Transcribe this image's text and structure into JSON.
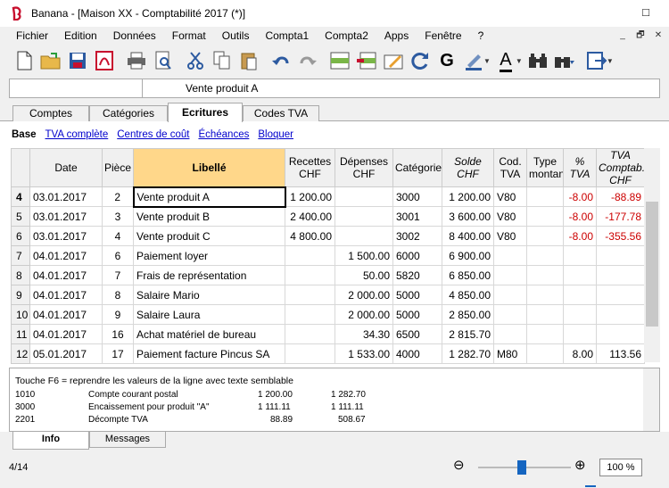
{
  "window": {
    "title": "Banana - [Maison XX - Comptabilité 2017 (*)]",
    "min_glyph": "□"
  },
  "menu": [
    "Fichier",
    "Edition",
    "Données",
    "Format",
    "Outils",
    "Compta1",
    "Compta2",
    "Apps",
    "Fenêtre",
    "?"
  ],
  "mdi_controls": [
    "_",
    "🗗",
    "✕"
  ],
  "toolbar": {
    "icons": [
      "new-document-icon",
      "open-folder-icon",
      "save-icon",
      "pdf-icon",
      "print-icon",
      "print-preview-icon",
      "cut-icon",
      "copy-icon",
      "paste-icon",
      "undo-icon",
      "redo-icon",
      "insert-row-icon",
      "delete-row-icon",
      "edit-icon",
      "recalculate-icon",
      "bold-icon",
      "highlight-icon",
      "font-color-icon",
      "find-icon",
      "find-replace-icon",
      "export-icon"
    ],
    "bold_glyph": "G",
    "font_glyph": "A"
  },
  "formula_bar": {
    "cell_ref": "",
    "cell_value": "Vente produit A"
  },
  "tabs": [
    "Comptes",
    "Catégories",
    "Ecritures",
    "Codes TVA"
  ],
  "active_tab": "Ecritures",
  "views": {
    "base": "Base",
    "links": [
      "TVA complète",
      "Centres de coût",
      "Échéances",
      "Bloquer"
    ]
  },
  "table": {
    "headers": {
      "date": "Date",
      "piece": "Pièce",
      "libelle": "Libellé",
      "recettes": "Recettes CHF",
      "depenses": "Dépenses CHF",
      "categorie": "Catégorie",
      "solde": "Solde CHF",
      "codtva": "Cod. TVA",
      "typemontant": "Type montant",
      "pcttva": "% TVA",
      "tvacomptab": "TVA Comptab. CHF"
    },
    "rows": [
      {
        "n": "4",
        "date": "03.01.2017",
        "piece": "2",
        "libelle": "Vente produit A",
        "recettes": "1 200.00",
        "depenses": "",
        "categorie": "3000",
        "solde": "1 200.00",
        "codtva": "V80",
        "typemontant": "",
        "pcttva": "-8.00",
        "tvacomptab": "-88.89"
      },
      {
        "n": "5",
        "date": "03.01.2017",
        "piece": "3",
        "libelle": "Vente produit B",
        "recettes": "2 400.00",
        "depenses": "",
        "categorie": "3001",
        "solde": "3 600.00",
        "codtva": "V80",
        "typemontant": "",
        "pcttva": "-8.00",
        "tvacomptab": "-177.78"
      },
      {
        "n": "6",
        "date": "03.01.2017",
        "piece": "4",
        "libelle": "Vente produit C",
        "recettes": "4 800.00",
        "depenses": "",
        "categorie": "3002",
        "solde": "8 400.00",
        "codtva": "V80",
        "typemontant": "",
        "pcttva": "-8.00",
        "tvacomptab": "-355.56"
      },
      {
        "n": "7",
        "date": "04.01.2017",
        "piece": "6",
        "libelle": "Paiement loyer",
        "recettes": "",
        "depenses": "1 500.00",
        "categorie": "6000",
        "solde": "6 900.00",
        "codtva": "",
        "typemontant": "",
        "pcttva": "",
        "tvacomptab": ""
      },
      {
        "n": "8",
        "date": "04.01.2017",
        "piece": "7",
        "libelle": "Frais de représentation",
        "recettes": "",
        "depenses": "50.00",
        "categorie": "5820",
        "solde": "6 850.00",
        "codtva": "",
        "typemontant": "",
        "pcttva": "",
        "tvacomptab": ""
      },
      {
        "n": "9",
        "date": "04.01.2017",
        "piece": "8",
        "libelle": "Salaire Mario",
        "recettes": "",
        "depenses": "2 000.00",
        "categorie": "5000",
        "solde": "4 850.00",
        "codtva": "",
        "typemontant": "",
        "pcttva": "",
        "tvacomptab": ""
      },
      {
        "n": "10",
        "date": "04.01.2017",
        "piece": "9",
        "libelle": "Salaire Laura",
        "recettes": "",
        "depenses": "2 000.00",
        "categorie": "5000",
        "solde": "2 850.00",
        "codtva": "",
        "typemontant": "",
        "pcttva": "",
        "tvacomptab": ""
      },
      {
        "n": "11",
        "date": "04.01.2017",
        "piece": "16",
        "libelle": "Achat matériel de bureau",
        "recettes": "",
        "depenses": "34.30",
        "categorie": "6500",
        "solde": "2 815.70",
        "codtva": "",
        "typemontant": "",
        "pcttva": "",
        "tvacomptab": ""
      },
      {
        "n": "12",
        "date": "05.01.2017",
        "piece": "17",
        "libelle": "Paiement facture Pincus SA",
        "recettes": "",
        "depenses": "1 533.00",
        "categorie": "4000",
        "solde": "1 282.70",
        "codtva": "M80",
        "typemontant": "",
        "pcttva": "8.00",
        "tvacomptab": "113.56"
      }
    ]
  },
  "info": {
    "message": "Touche F6 = reprendre les valeurs de la ligne avec texte semblable",
    "rows": [
      {
        "account": "1010",
        "desc": "Compte courant postal",
        "amount": "1 200.00",
        "balance": "1 282.70"
      },
      {
        "account": "3000",
        "desc": "Encaissement pour produit \"A\"",
        "amount": "1 111.11",
        "balance": "1 111.11"
      },
      {
        "account": "2201",
        "desc": "Décompte TVA",
        "amount": "88.89",
        "balance": "508.67"
      }
    ]
  },
  "bottom_tabs": [
    "Info",
    "Messages"
  ],
  "status": {
    "position": "4/14",
    "zoom": "100 %"
  },
  "colors": {
    "libelle_header": "#ffd78a",
    "negative": "#cc0000",
    "zoom_thumb": "#1565c0"
  }
}
